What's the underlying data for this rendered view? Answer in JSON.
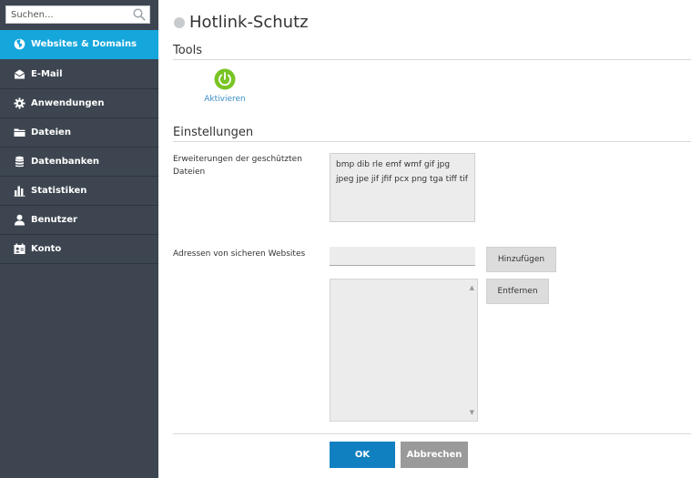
{
  "search": {
    "placeholder": "Suchen..."
  },
  "sidebar": {
    "items": [
      {
        "label": "Websites & Domains",
        "icon": "globe-icon",
        "active": true
      },
      {
        "label": "E-Mail",
        "icon": "envelope-icon"
      },
      {
        "label": "Anwendungen",
        "icon": "gear-icon"
      },
      {
        "label": "Dateien",
        "icon": "folder-icon"
      },
      {
        "label": "Datenbanken",
        "icon": "database-icon"
      },
      {
        "label": "Statistiken",
        "icon": "bar-chart-icon"
      },
      {
        "label": "Benutzer",
        "icon": "user-icon"
      },
      {
        "label": "Konto",
        "icon": "account-card-icon"
      }
    ]
  },
  "page": {
    "title": "Hotlink-Schutz"
  },
  "tools": {
    "title": "Tools",
    "activate_label": "Aktivieren"
  },
  "settings": {
    "title": "Einstellungen",
    "extensions_label": "Erweiterungen der geschützten Dateien",
    "extensions_value": "bmp dib rle emf wmf gif jpg jpeg jpe jif jfif pcx png tga tiff tif",
    "safe_sites_label": "Adressen von sicheren Websites",
    "safe_site_input": "",
    "add_label": "Hinzufügen",
    "remove_label": "Entfernen"
  },
  "footer": {
    "ok_label": "OK",
    "cancel_label": "Abbrechen"
  },
  "colors": {
    "sidebar_bg": "#3d4650",
    "active_item": "#15a6dc",
    "ok_button": "#1180c0",
    "power_icon": "#79c424",
    "link": "#3a8ec8"
  }
}
